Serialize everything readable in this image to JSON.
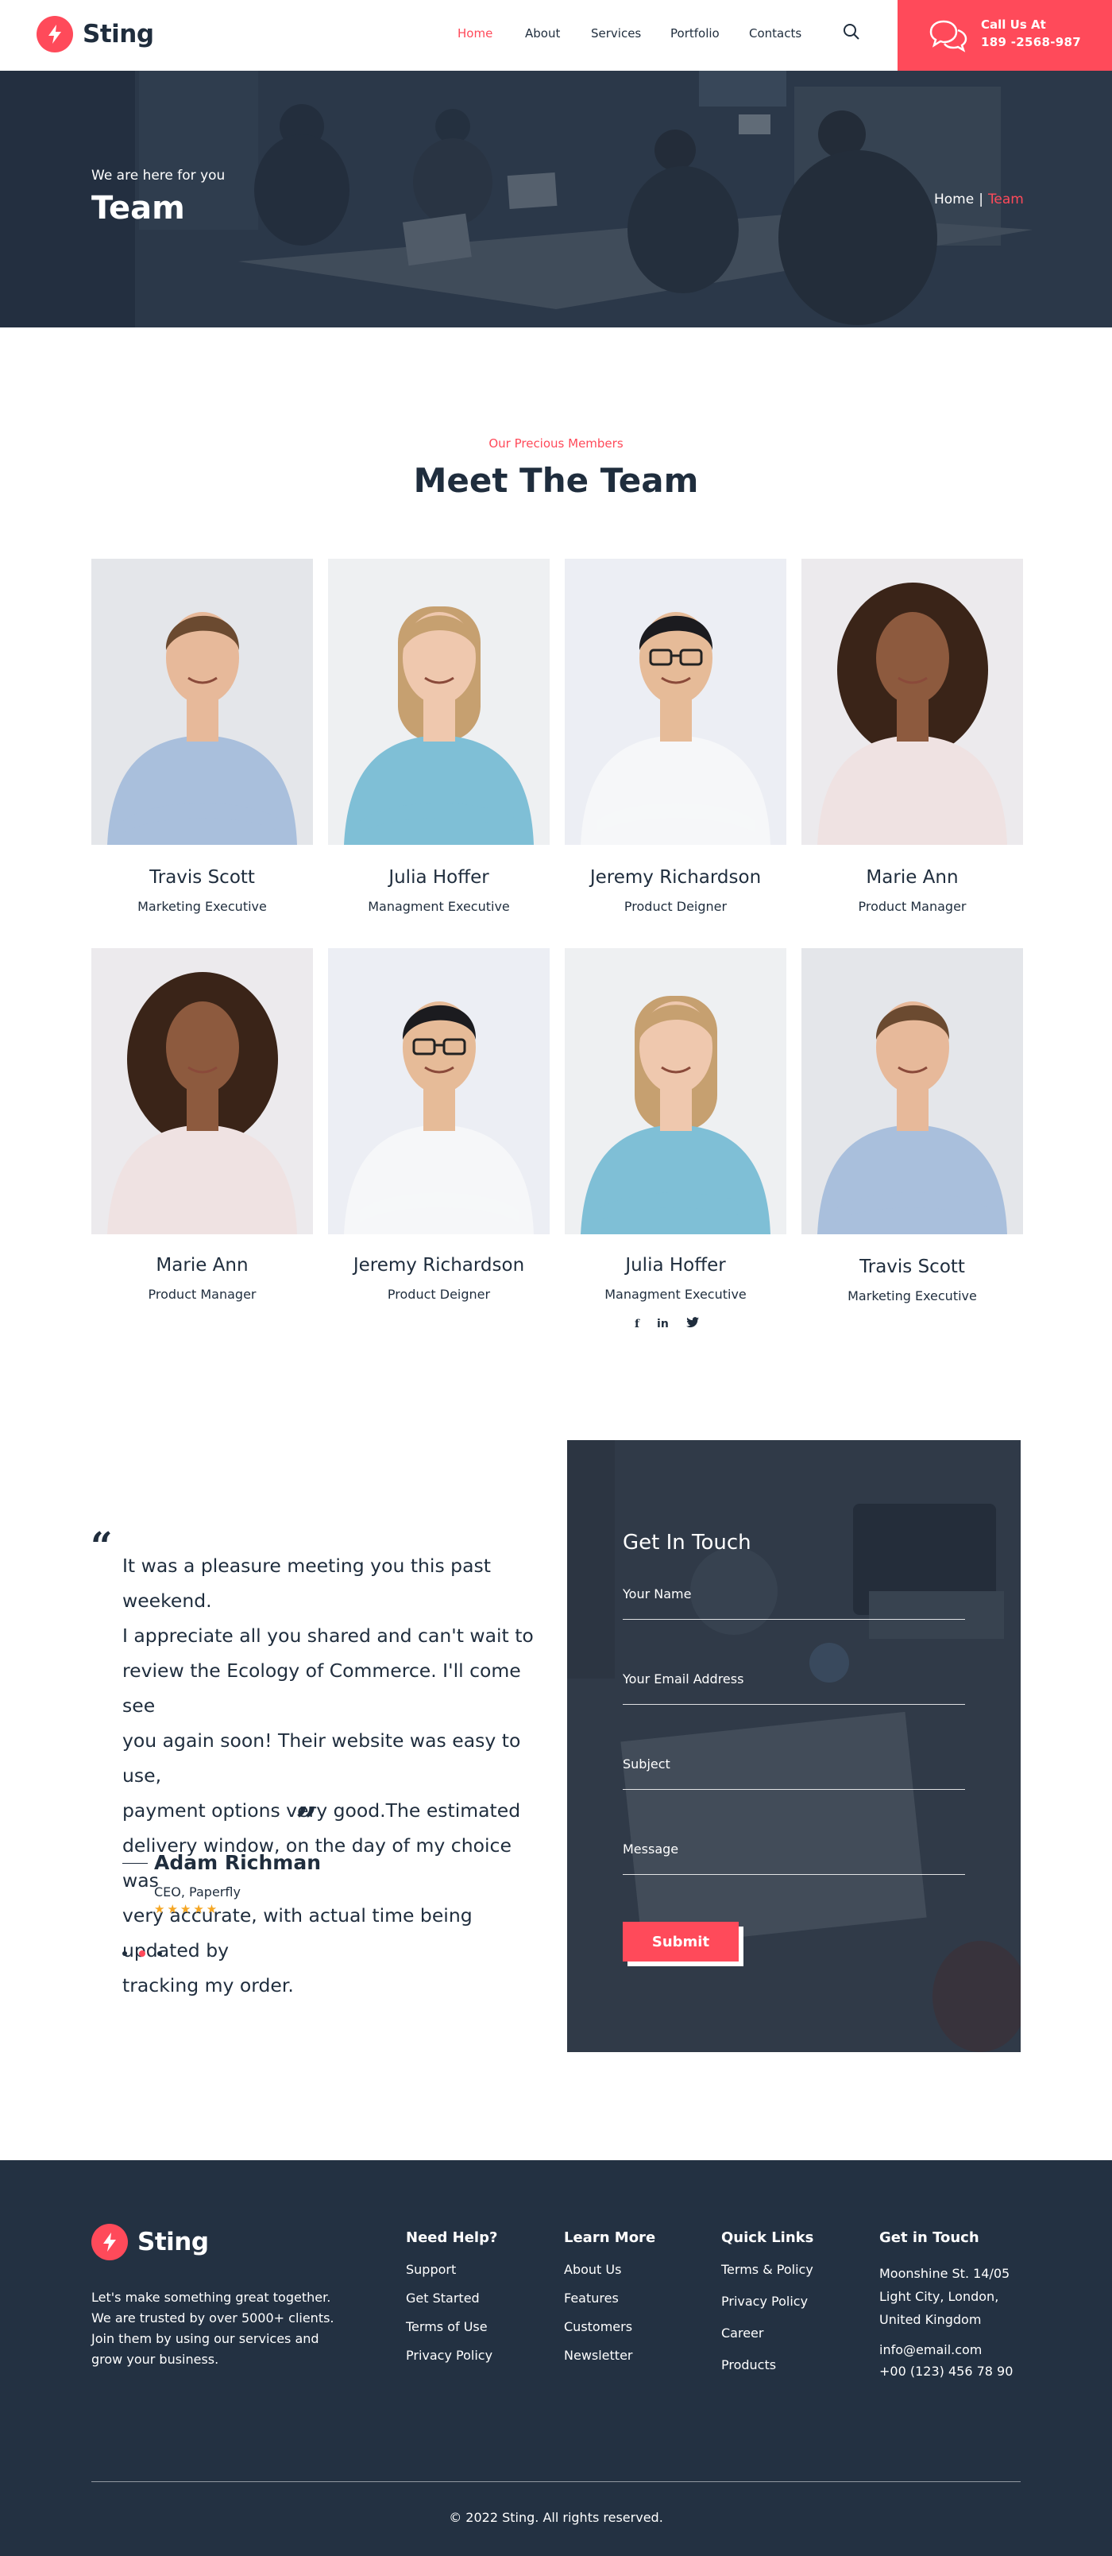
{
  "brand": {
    "name": "Sting",
    "accent": "#ff4a5a",
    "dark": "#233142",
    "text": "#1f2d3d"
  },
  "nav": {
    "items": [
      {
        "label": "Home",
        "active": true
      },
      {
        "label": "About",
        "active": false
      },
      {
        "label": "Services",
        "active": false
      },
      {
        "label": "Portfolio",
        "active": false
      },
      {
        "label": "Contacts",
        "active": false
      }
    ],
    "search_icon": "search-icon"
  },
  "call": {
    "title": "Call Us At",
    "number": "189 -2568-987",
    "icon": "chat-bubbles-icon"
  },
  "hero": {
    "subtitle": "We are here for you",
    "title": "Team",
    "breadcrumb": {
      "home": "Home",
      "separator": "|",
      "current": "Team"
    }
  },
  "team": {
    "eyebrow": "Our Precious Members",
    "title": "Meet The Team",
    "members": [
      {
        "name": "Travis Scott",
        "role": "Marketing Executive",
        "avatar": "man-denim-shirt"
      },
      {
        "name": "Julia Hoffer",
        "role": "Managment Executive",
        "avatar": "woman-blue-sweater"
      },
      {
        "name": "Jeremy Richardson",
        "role": "Product Deigner",
        "avatar": "man-glasses-white-shirt"
      },
      {
        "name": "Marie Ann",
        "role": "Product Manager",
        "avatar": "woman-curly-hair"
      },
      {
        "name": "Marie Ann",
        "role": "Product Manager",
        "avatar": "woman-curly-hair"
      },
      {
        "name": "Jeremy Richardson",
        "role": "Product Deigner",
        "avatar": "man-glasses-white-shirt"
      },
      {
        "name": "Julia Hoffer",
        "role": "Managment Executive",
        "avatar": "woman-blue-sweater"
      },
      {
        "name": "Travis Scott",
        "role": "Marketing Executive",
        "avatar": "man-denim-shirt"
      }
    ],
    "socials": [
      "facebook-icon",
      "linkedin-icon",
      "twitter-icon"
    ],
    "social_glyphs": {
      "facebook": "f",
      "linkedin": "in"
    }
  },
  "testimonial": {
    "open_quote": "“",
    "close_quote": "”",
    "lines": [
      "It was a pleasure meeting you this past weekend.",
      "I appreciate all you shared and can't wait to",
      "review the Ecology of Commerce. I'll come see",
      "you again soon! Their website was easy to use,",
      "payment options very good.The estimated",
      "delivery window, on the day of my choice was",
      "very accurate, with actual time being updated by",
      "tracking my order."
    ],
    "author": "Adam Richman",
    "role": "CEO, Paperfly",
    "rating": 5,
    "stars": "★★★★★",
    "slides": 3,
    "active_slide": 2
  },
  "contact": {
    "title": "Get In Touch",
    "fields": {
      "name": "Your Name",
      "email": "Your Email Address",
      "subject": "Subject",
      "message": "Message"
    },
    "submit": "Submit"
  },
  "footer": {
    "about": "Let's make something great together. We are trusted by over 5000+ clients. Join them by using our services and grow your business.",
    "columns": [
      {
        "title": "Need Help?",
        "links": [
          "Support",
          "Get Started",
          "Terms of Use",
          "Privacy Policy"
        ]
      },
      {
        "title": "Learn More",
        "links": [
          "About Us",
          "Features",
          "Customers",
          "Newsletter"
        ]
      },
      {
        "title": "Quick Links",
        "links": [
          "Terms & Policy",
          "Privacy Policy",
          "Career",
          "Products"
        ]
      }
    ],
    "contact": {
      "title": "Get in Touch",
      "address": [
        "Moonshine St. 14/05",
        "Light City, London,",
        "United Kingdom"
      ],
      "email": "info@email.com",
      "phone": "+00 (123) 456 78 90"
    },
    "copyright": "© 2022 Sting. All rights reserved."
  }
}
